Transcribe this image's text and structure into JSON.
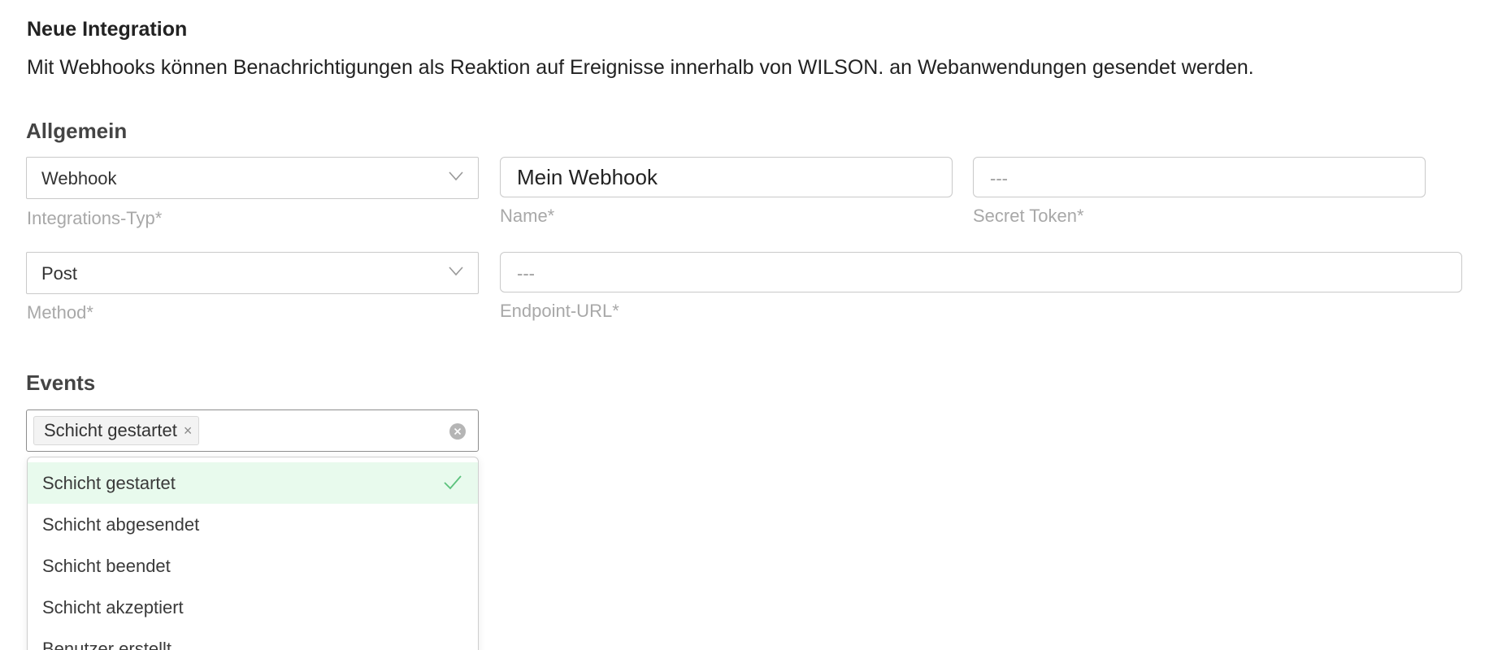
{
  "header": {
    "title": "Neue Integration",
    "description": "Mit Webhooks können Benachrichtigungen als Reaktion auf Ereignisse innerhalb von WILSON. an Webanwendungen gesendet werden."
  },
  "general": {
    "section_title": "Allgemein",
    "integration_type": {
      "value": "Webhook",
      "label": "Integrations-Typ*"
    },
    "name": {
      "value": "Mein Webhook",
      "label": "Name*"
    },
    "secret_token": {
      "value": "",
      "placeholder": "---",
      "label": "Secret Token*"
    },
    "method": {
      "value": "Post",
      "label": "Method*"
    },
    "endpoint_url": {
      "value": "",
      "placeholder": "---",
      "label": "Endpoint-URL*"
    }
  },
  "events": {
    "section_title": "Events",
    "selected_tags": [
      "Schicht gestartet"
    ],
    "tag_close_symbol": "×",
    "options": [
      {
        "label": "Schicht gestartet",
        "selected": true
      },
      {
        "label": "Schicht abgesendet",
        "selected": false
      },
      {
        "label": "Schicht beendet",
        "selected": false
      },
      {
        "label": "Schicht akzeptiert",
        "selected": false
      },
      {
        "label": "Benutzer erstellt",
        "selected": false
      }
    ]
  },
  "icons": {
    "select_chevron": "chevron-down-icon",
    "tag_remove": "close-icon",
    "clear_all": "clear-circle-icon",
    "option_selected": "check-icon"
  },
  "colors": {
    "selected_option_bg": "#e8faed",
    "check_color": "#5cc27d",
    "label_color": "#a8a8a8"
  }
}
